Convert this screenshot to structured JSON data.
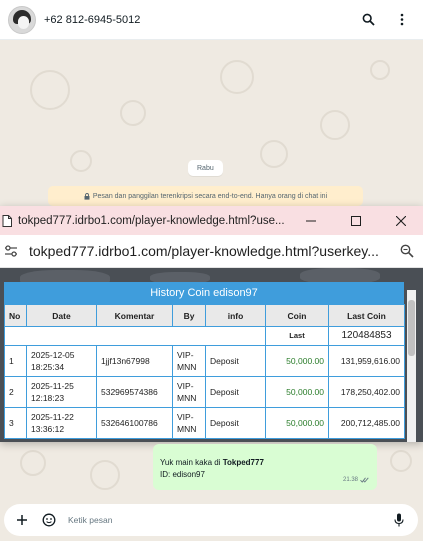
{
  "chat": {
    "contact": "+62 812-6945-5012",
    "date_pill": "Rabu",
    "encryption_note": "Pesan dan panggilan terenkripsi secara end-to-end. Hanya orang di chat ini",
    "compose_placeholder": "Ketik pesan",
    "message": {
      "line1_prefix": "Yuk main kaka di ",
      "line1_bold": "Tokped777",
      "line2": "ID: edison97",
      "time": "21.38"
    }
  },
  "browser": {
    "window_title": "tokped777.idrbo1.com/player-knowledge.html?use...",
    "url": "tokped777.idrbo1.com/player-knowledge.html?userkey..."
  },
  "history": {
    "title": "History Coin edison97",
    "columns": [
      "No",
      "Date",
      "Komentar",
      "By",
      "info",
      "Coin",
      "Last Coin"
    ],
    "last_label": "Last",
    "last_value": "120484853",
    "rows": [
      {
        "no": "1",
        "date": "2025-12-05 18:25:34",
        "komentar": "1jjf13n67998",
        "by": "VIP-MNN",
        "info": "Deposit",
        "coin": "50,000.00",
        "last_coin": "131,959,616.00"
      },
      {
        "no": "2",
        "date": "2025-11-25 12:18:23",
        "komentar": "532969574386",
        "by": "VIP-MNN",
        "info": "Deposit",
        "coin": "50,000.00",
        "last_coin": "178,250,402.00"
      },
      {
        "no": "3",
        "date": "2025-11-22 13:36:12",
        "komentar": "532646100786",
        "by": "VIP-MNN",
        "info": "Deposit",
        "coin": "50,000.00",
        "last_coin": "200,712,485.00"
      }
    ]
  },
  "colors": {
    "table_header": "#3f9ddc",
    "title_bar": "#f9dfe2",
    "bubble": "#d9fdd3",
    "coin_text": "#2a7c2a"
  },
  "icons": {
    "header": [
      "search-icon",
      "more-vert-icon"
    ],
    "window": [
      "site-page-icon",
      "minimize-icon",
      "maximize-icon",
      "close-icon"
    ],
    "url_bar": [
      "tune-icon",
      "zoom-icon"
    ],
    "compose": [
      "plus-icon",
      "sticker-icon",
      "mic-icon"
    ]
  }
}
